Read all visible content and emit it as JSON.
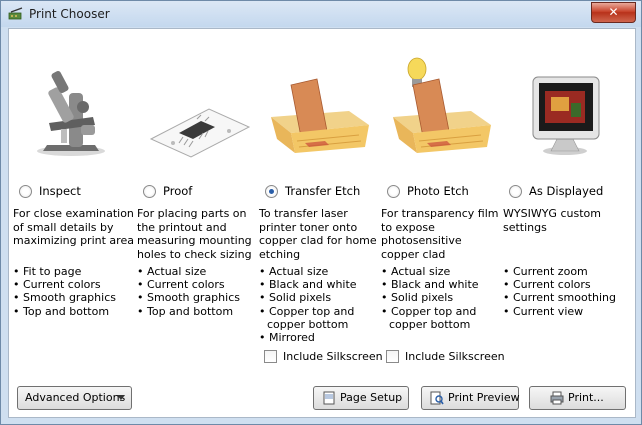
{
  "window": {
    "title": "Print Chooser",
    "close_glyph": "✕"
  },
  "options": [
    {
      "label": "Inspect",
      "selected": false,
      "icon": "microscope-icon",
      "description": "For close examination of small details by maximizing print area",
      "bullets": [
        "Fit to page",
        "Current colors",
        "Smooth graphics",
        "Top and bottom"
      ]
    },
    {
      "label": "Proof",
      "selected": false,
      "icon": "circuit-board-printout-icon",
      "description": "For placing parts on the printout and measuring mounting holes to check sizing",
      "bullets": [
        "Actual size",
        "Current colors",
        "Smooth graphics",
        "Top and bottom"
      ]
    },
    {
      "label": "Transfer Etch",
      "selected": true,
      "icon": "etch-tray-icon",
      "description": "To transfer laser printer toner onto copper clad for home etching",
      "bullets": [
        "Actual size",
        "Black and white",
        "Solid pixels",
        "Copper top and copper bottom",
        "Mirrored"
      ],
      "checkbox": {
        "label": "Include Silkscreen",
        "checked": false
      }
    },
    {
      "label": "Photo Etch",
      "selected": false,
      "icon": "photo-etch-tray-lamp-icon",
      "description": "For transparency film to expose photosensitive copper clad",
      "bullets": [
        "Actual size",
        "Black and white",
        "Solid pixels",
        "Copper top and copper bottom"
      ],
      "checkbox": {
        "label": "Include Silkscreen",
        "checked": false
      }
    },
    {
      "label": "As Displayed",
      "selected": false,
      "icon": "monitor-icon",
      "description": "WYSIWYG custom settings",
      "bullets": [
        "Current zoom",
        "Current colors",
        "Current smoothing",
        "Current view"
      ]
    }
  ],
  "footer": {
    "advanced_options": "Advanced Options",
    "page_setup": "Page Setup",
    "print_preview": "Print Preview",
    "print": "Print..."
  },
  "colors": {
    "selected_radio": "#2a5ea8",
    "close_button": "#c8442c",
    "copper": "#d88a55"
  }
}
